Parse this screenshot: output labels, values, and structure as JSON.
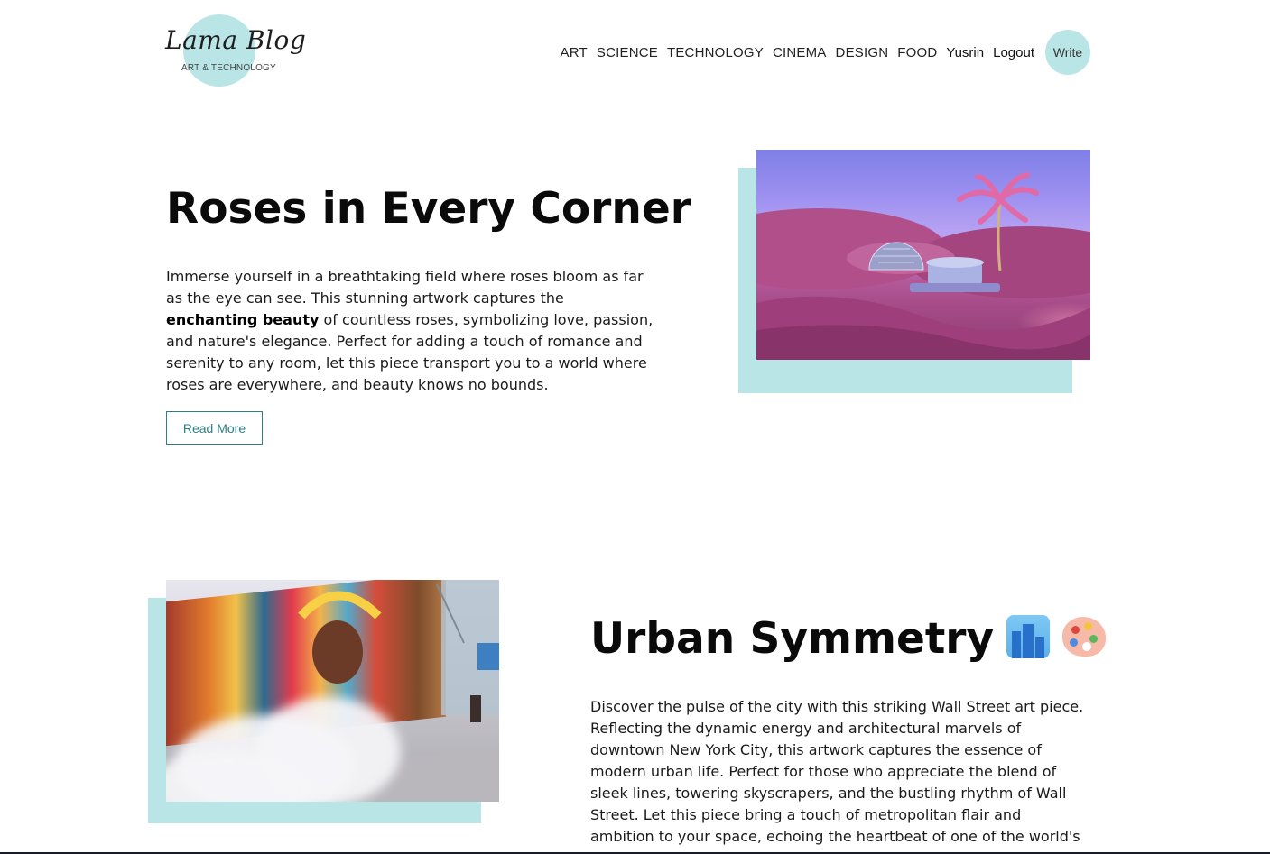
{
  "header": {
    "logo_title": "Lama Blog",
    "logo_subtitle": "ART & TECHNOLOGY",
    "nav_links": [
      "ART",
      "SCIENCE",
      "TECHNOLOGY",
      "CINEMA",
      "DESIGN",
      "FOOD"
    ],
    "user": "Yusrin",
    "logout": "Logout",
    "write": "Write"
  },
  "posts": [
    {
      "title": "Roses in Every Corner",
      "text_before": "Immerse yourself in a breathtaking field where roses bloom as far as the eye can see. This stunning artwork captures the ",
      "text_bold": "enchanting beauty",
      "text_after": " of countless roses, symbolizing love, passion, and nature's elegance. Perfect for adding a touch of romance and serenity to any room, let this piece transport you to a world where roses are everywhere, and beauty knows no bounds.",
      "button": "Read More"
    },
    {
      "title": "Urban Symmetry",
      "emoji_1": "cityscape-emoji",
      "emoji_2": "artist-palette-emoji",
      "text": "Discover the pulse of the city with this striking Wall Street art piece. Reflecting the dynamic energy and architectural marvels of downtown New York City, this artwork captures the essence of modern urban life. Perfect for those who appreciate the blend of sleek lines, towering skyscrapers, and the bustling rhythm of Wall Street. Let this piece bring a touch of metropolitan flair and ambition to your space, echoing the heartbeat of one of the world's financial"
    }
  ],
  "colors": {
    "accent": "#b9e5e7",
    "button_border": "#2e7f85"
  }
}
